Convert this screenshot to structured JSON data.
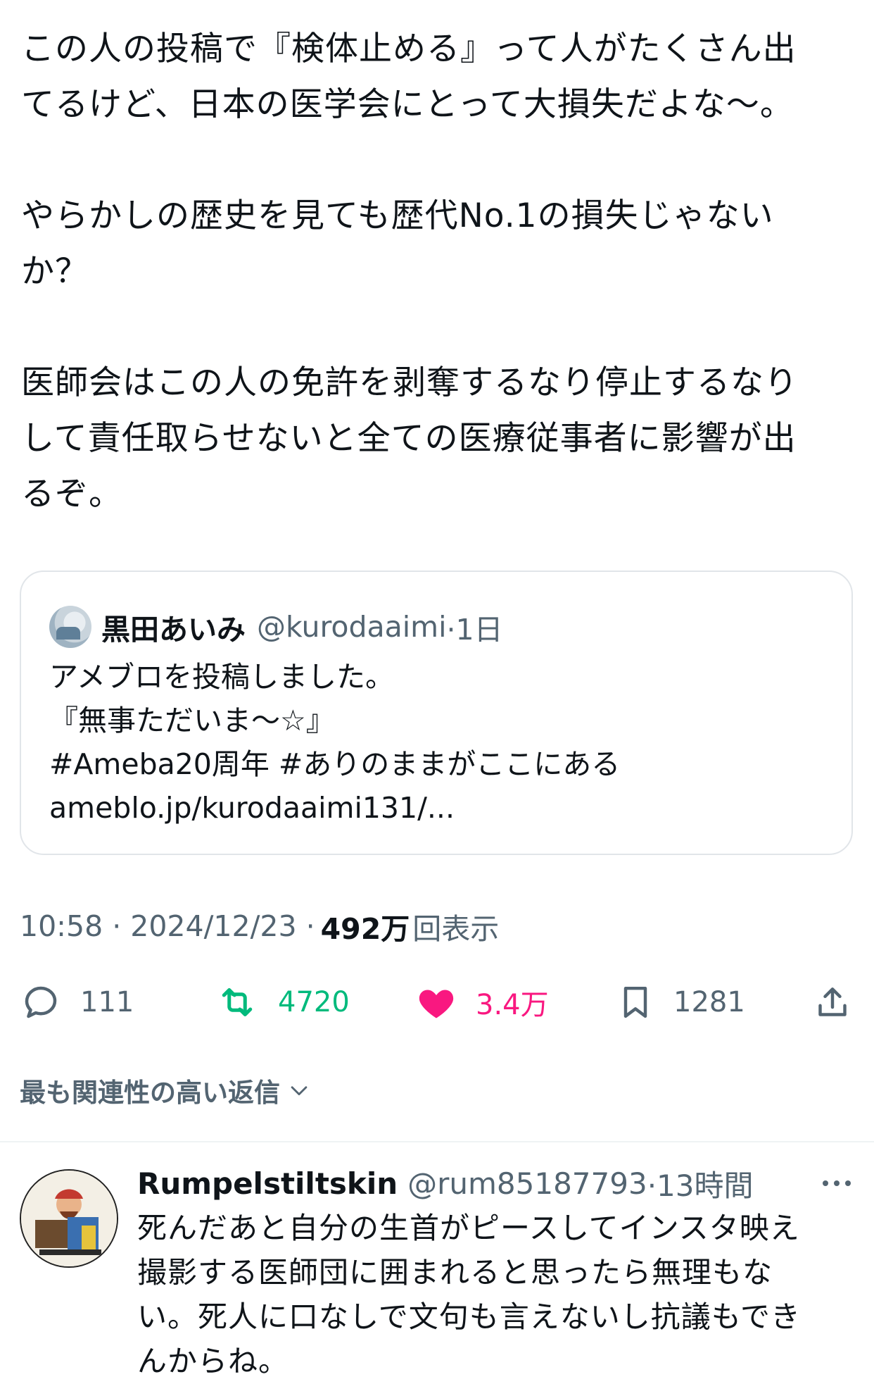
{
  "post": {
    "text": "この人の投稿で『検体止める』って人がたくさん出\nてるけど、日本の医学会にとって大損失だよな〜。\n\nやらかしの歴史を見ても歴代No.1の損失じゃない\nか？\n\n医師会はこの人の免許を剥奪するなり停止するなり\nして責任取らせないと全ての医療従事者に影響が出\nるぞ。"
  },
  "quote": {
    "name": "黒田あいみ",
    "handle": "@kurodaaimi",
    "time": "·1日",
    "lines": [
      "アメブロを投稿しました。",
      "『無事ただいま〜☆』",
      "#Ameba20周年 #ありのままがここにある",
      " ameblo.jp/kurodaaimi131/..."
    ]
  },
  "meta": {
    "time_date": "10:58 · 2024/12/23 ·",
    "views_count": "492万",
    "views_label": "回表示"
  },
  "actions": {
    "replies": "111",
    "reposts": "4720",
    "likes": "3.4万",
    "bookmarks": "1281"
  },
  "colors": {
    "text": "#0f1419",
    "secondary": "#536471",
    "repost_green": "#00ba7c",
    "like_pink": "#f91880",
    "border": "#e1e5e9"
  },
  "relevant": {
    "label": "最も関連性の高い返信"
  },
  "reply": {
    "name": "Rumpelstiltskin",
    "handle": "@rum85187793",
    "time": "·13時間",
    "text": "死んだあと自分の生首がピースしてインスタ映え\n撮影する医師団に囲まれると思ったら無理もな\nい。死人に口なしで文句も言えないし抗議もでき\nんからね。"
  }
}
